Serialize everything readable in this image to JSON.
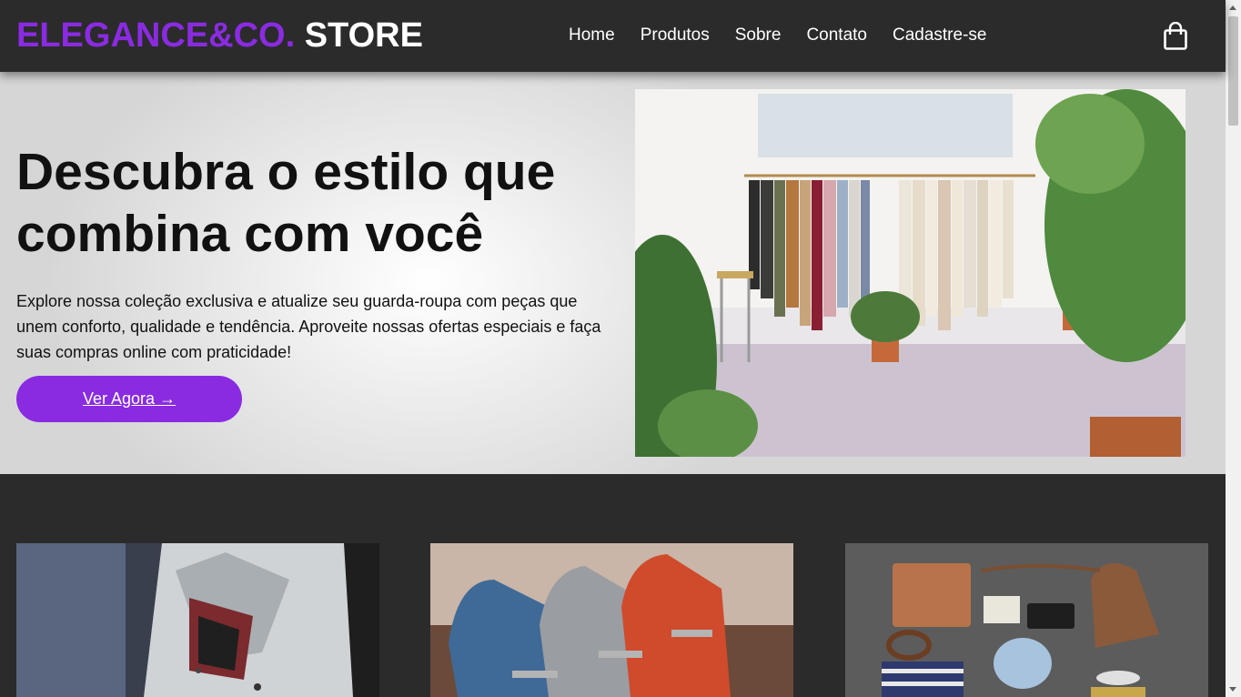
{
  "header": {
    "logo_brand": "ELEGANCE&CO.",
    "logo_store": "STORE",
    "nav": [
      "Home",
      "Produtos",
      "Sobre",
      "Contato",
      "Cadastre-se"
    ],
    "cart_icon": "shopping-bag-icon"
  },
  "hero": {
    "title": "Descubra o estilo que combina com você",
    "text": "Explore nossa coleção exclusiva e atualize seu guarda-roupa com peças que unem conforto, qualidade e tendência. Aproveite nossas ofertas especiais e faça suas compras online com praticidade!",
    "cta": "Ver Agora →"
  },
  "colors": {
    "accent": "#8a2be2",
    "header_bg": "#2b2b2b",
    "text": "#111111"
  }
}
